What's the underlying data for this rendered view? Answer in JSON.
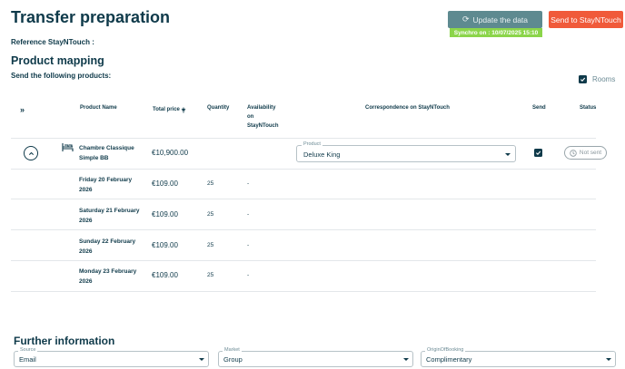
{
  "header": {
    "title": "Transfer preparation",
    "update_button": "Update the data",
    "send_button": "Send to StayNTouch",
    "synchro_label": "Synchro on : 10/07/2025 15:10",
    "reference_label": "Reference StayNTouch :"
  },
  "mapping": {
    "title": "Product mapping",
    "subtitle": "Send the following products:",
    "rooms_toggle": {
      "label": "Rooms",
      "checked": true
    }
  },
  "table": {
    "expand_all": "»",
    "columns": {
      "product_name": "Product Name",
      "total_price": "Total price",
      "quantity": "Quantity",
      "availability": [
        "Availability",
        "on",
        "StayNTouch"
      ],
      "correspondence": "Correspondence on StayNTouch",
      "send": "Send",
      "status": "Status"
    },
    "product": {
      "name_lines": [
        "Chambre Classique",
        "Simple BB"
      ],
      "total_price": "€10,900.00",
      "select_label": "Product",
      "select_value": "Deluxe King",
      "send_checked": true,
      "status": "Not sent"
    },
    "days": [
      {
        "lines": [
          "Friday 20 February",
          "2026"
        ],
        "price": "€109.00",
        "qty": "25",
        "avail": "-"
      },
      {
        "lines": [
          "Saturday 21 February",
          "2026"
        ],
        "price": "€109.00",
        "qty": "25",
        "avail": "-"
      },
      {
        "lines": [
          "Sunday 22 February",
          "2026"
        ],
        "price": "€109.00",
        "qty": "25",
        "avail": "-"
      },
      {
        "lines": [
          "Monday 23 February",
          "2026"
        ],
        "price": "€109.00",
        "qty": "25",
        "avail": "-"
      }
    ]
  },
  "further": {
    "title": "Further information",
    "source": {
      "label": "Source",
      "value": "Email"
    },
    "market": {
      "label": "Market",
      "value": "Group"
    },
    "origin": {
      "label": "OriginOfBooking",
      "value": "Complimentary"
    }
  },
  "colors": {
    "primary": "#0f3a4a",
    "update_button": "#5e8a90",
    "send_button": "#f05a3a",
    "synchro_badge": "#8bd54a"
  },
  "icons": [
    "refresh-icon",
    "cross-icon",
    "chevron-up-icon",
    "bed-icon",
    "clock-icon",
    "check-icon",
    "caret-down-icon"
  ]
}
